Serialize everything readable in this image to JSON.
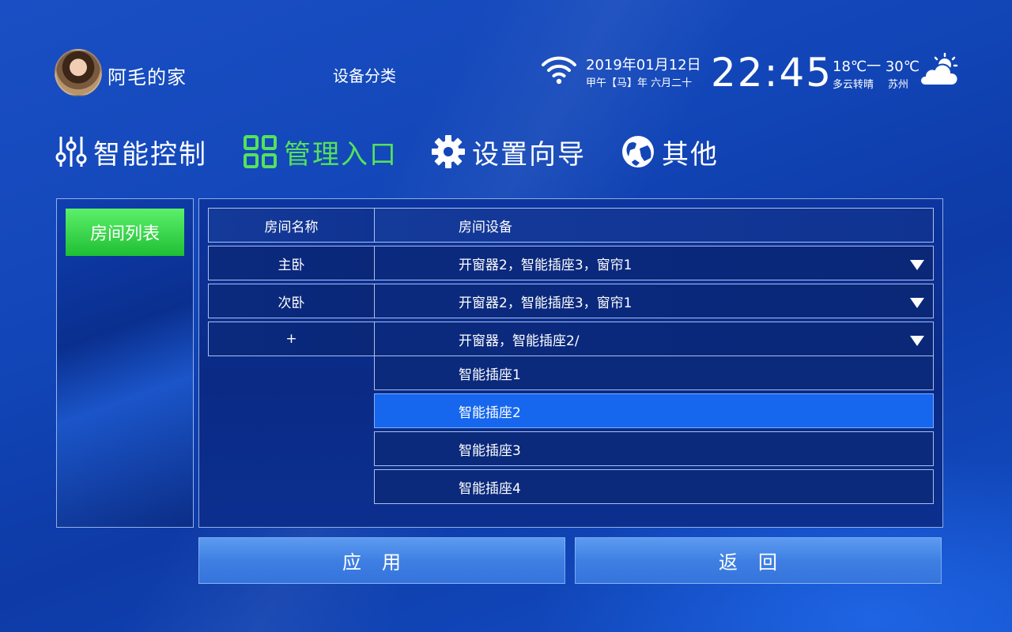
{
  "header": {
    "home_name": "阿毛的家",
    "page_category": "设备分类",
    "date": "2019年01月12日",
    "lunar_date": "甲午【马】年 六月二十",
    "time": "22:45",
    "temperature": "18℃一 30℃",
    "weather": "多云转晴",
    "city": "苏州"
  },
  "nav": [
    {
      "label": "智能控制",
      "icon": "sliders-icon",
      "active": false
    },
    {
      "label": "管理入口",
      "icon": "grid-icon",
      "active": true
    },
    {
      "label": "设置向导",
      "icon": "gear-icon",
      "active": false
    },
    {
      "label": "其他",
      "icon": "globe-icon",
      "active": false
    }
  ],
  "sidebar": {
    "room_list_label": "房间列表"
  },
  "table": {
    "headers": {
      "name": "房间名称",
      "devices": "房间设备"
    },
    "rows": [
      {
        "name": "主卧",
        "devices": "开窗器2，智能插座3，窗帘1"
      },
      {
        "name": "次卧",
        "devices": "开窗器2，智能插座3，窗帘1"
      },
      {
        "name": "+",
        "devices": "开窗器，智能插座2/"
      }
    ],
    "dropdown_options": [
      "智能插座1",
      "智能插座2",
      "智能插座3",
      "智能插座4"
    ],
    "selected_option": "智能插座2"
  },
  "buttons": {
    "apply": "应用",
    "back": "返回"
  },
  "colors": {
    "accent_green": "#54e25a",
    "selected_blue": "#1667ee",
    "background": "#1246b8"
  }
}
